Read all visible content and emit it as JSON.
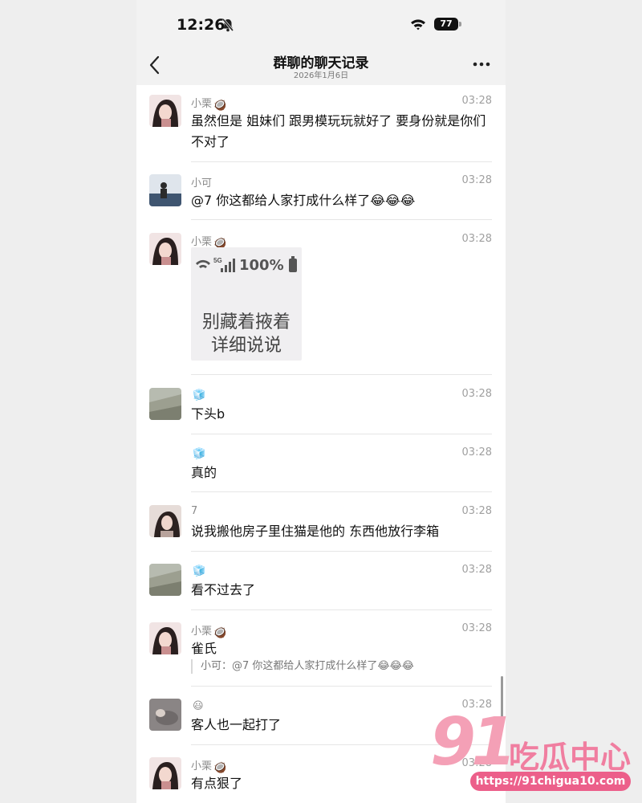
{
  "status_bar": {
    "time": "12:26",
    "battery": "77"
  },
  "header": {
    "title": "群聊的聊天记录",
    "subtitle": "2026年1月6日"
  },
  "colors": {
    "avatar_xiaoli": "#c98f8f",
    "avatar_xiaoke": "#3f5570",
    "avatar_ice": "#9c9f90",
    "avatar_7": "#b8a39c",
    "avatar_smile": "#6f6a6a"
  },
  "sticker": {
    "percent": "100%",
    "line1": "别藏着掖着",
    "line2": "详细说说"
  },
  "messages": [
    {
      "name": "小栗",
      "name_emoji": "🥥",
      "time": "03:28",
      "text": "虽然但是 姐妹们 跟男模玩玩就好了 要身份就是你们不对了"
    },
    {
      "name": "小可",
      "name_emoji": "",
      "time": "03:28",
      "text": "@7 你这都给人家打成什么样了😂😂😂"
    },
    {
      "name": "小栗",
      "name_emoji": "🥥",
      "time": "03:28",
      "text": ""
    },
    {
      "name": "",
      "name_emoji": "🧊",
      "time": "03:28",
      "text": "下头b"
    },
    {
      "name": "",
      "name_emoji": "🧊",
      "time": "03:28",
      "text": "真的"
    },
    {
      "name": "7",
      "name_emoji": "",
      "time": "03:28",
      "text": "说我搬他房子里住猫是他的 东西他放行李箱"
    },
    {
      "name": "",
      "name_emoji": "🧊",
      "time": "03:28",
      "text": "看不过去了"
    },
    {
      "name": "小栗",
      "name_emoji": "🥥",
      "time": "03:28",
      "text": "雀氏",
      "quote": "小可：@7 你这都给人家打成什么样了😂😂😂"
    },
    {
      "name": "",
      "name_emoji": "😃",
      "time": "03:28",
      "text": "客人也一起打了"
    },
    {
      "name": "小栗",
      "name_emoji": "🥥",
      "time": "03:28",
      "text": "有点狠了"
    }
  ],
  "watermark": {
    "number": "91",
    "brand": "吃瓜中心",
    "url": "https://91chigua10.com"
  }
}
